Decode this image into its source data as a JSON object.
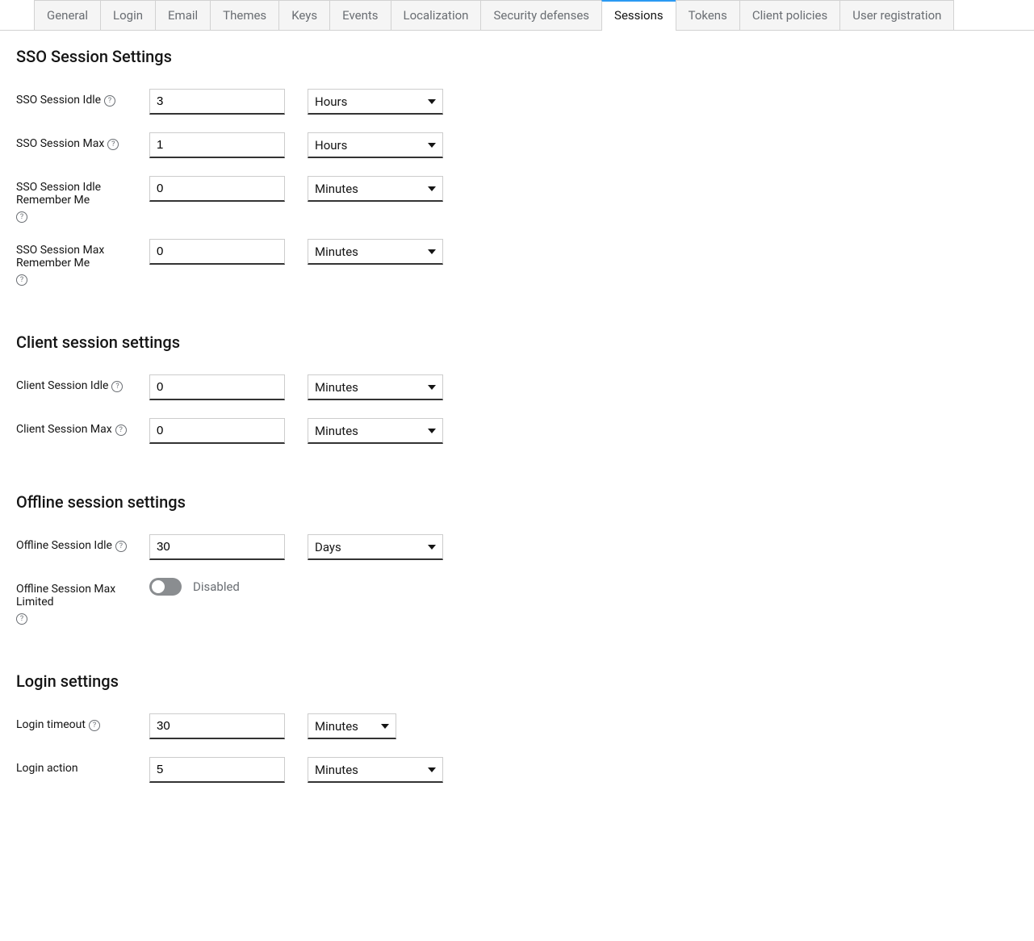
{
  "tabs": [
    {
      "label": "General",
      "active": false
    },
    {
      "label": "Login",
      "active": false
    },
    {
      "label": "Email",
      "active": false
    },
    {
      "label": "Themes",
      "active": false
    },
    {
      "label": "Keys",
      "active": false
    },
    {
      "label": "Events",
      "active": false
    },
    {
      "label": "Localization",
      "active": false
    },
    {
      "label": "Security defenses",
      "active": false
    },
    {
      "label": "Sessions",
      "active": true
    },
    {
      "label": "Tokens",
      "active": false
    },
    {
      "label": "Client policies",
      "active": false
    },
    {
      "label": "User registration",
      "active": false
    }
  ],
  "sections": {
    "sso": {
      "title": "SSO Session Settings",
      "idle": {
        "label": "SSO Session Idle",
        "value": "3",
        "unit": "Hours"
      },
      "max": {
        "label": "SSO Session Max",
        "value": "1",
        "unit": "Hours"
      },
      "idleRemember": {
        "label": "SSO Session Idle Remember Me",
        "value": "0",
        "unit": "Minutes"
      },
      "maxRemember": {
        "label": "SSO Session Max Remember Me",
        "value": "0",
        "unit": "Minutes"
      }
    },
    "client": {
      "title": "Client session settings",
      "idle": {
        "label": "Client Session Idle",
        "value": "0",
        "unit": "Minutes"
      },
      "max": {
        "label": "Client Session Max",
        "value": "0",
        "unit": "Minutes"
      }
    },
    "offline": {
      "title": "Offline session settings",
      "idle": {
        "label": "Offline Session Idle",
        "value": "30",
        "unit": "Days"
      },
      "maxLimited": {
        "label": "Offline Session Max Limited",
        "status": "Disabled"
      }
    },
    "login": {
      "title": "Login settings",
      "timeout": {
        "label": "Login timeout",
        "value": "30",
        "unit": "Minutes"
      },
      "action": {
        "label": "Login action",
        "value": "5",
        "unit": "Minutes"
      }
    }
  }
}
